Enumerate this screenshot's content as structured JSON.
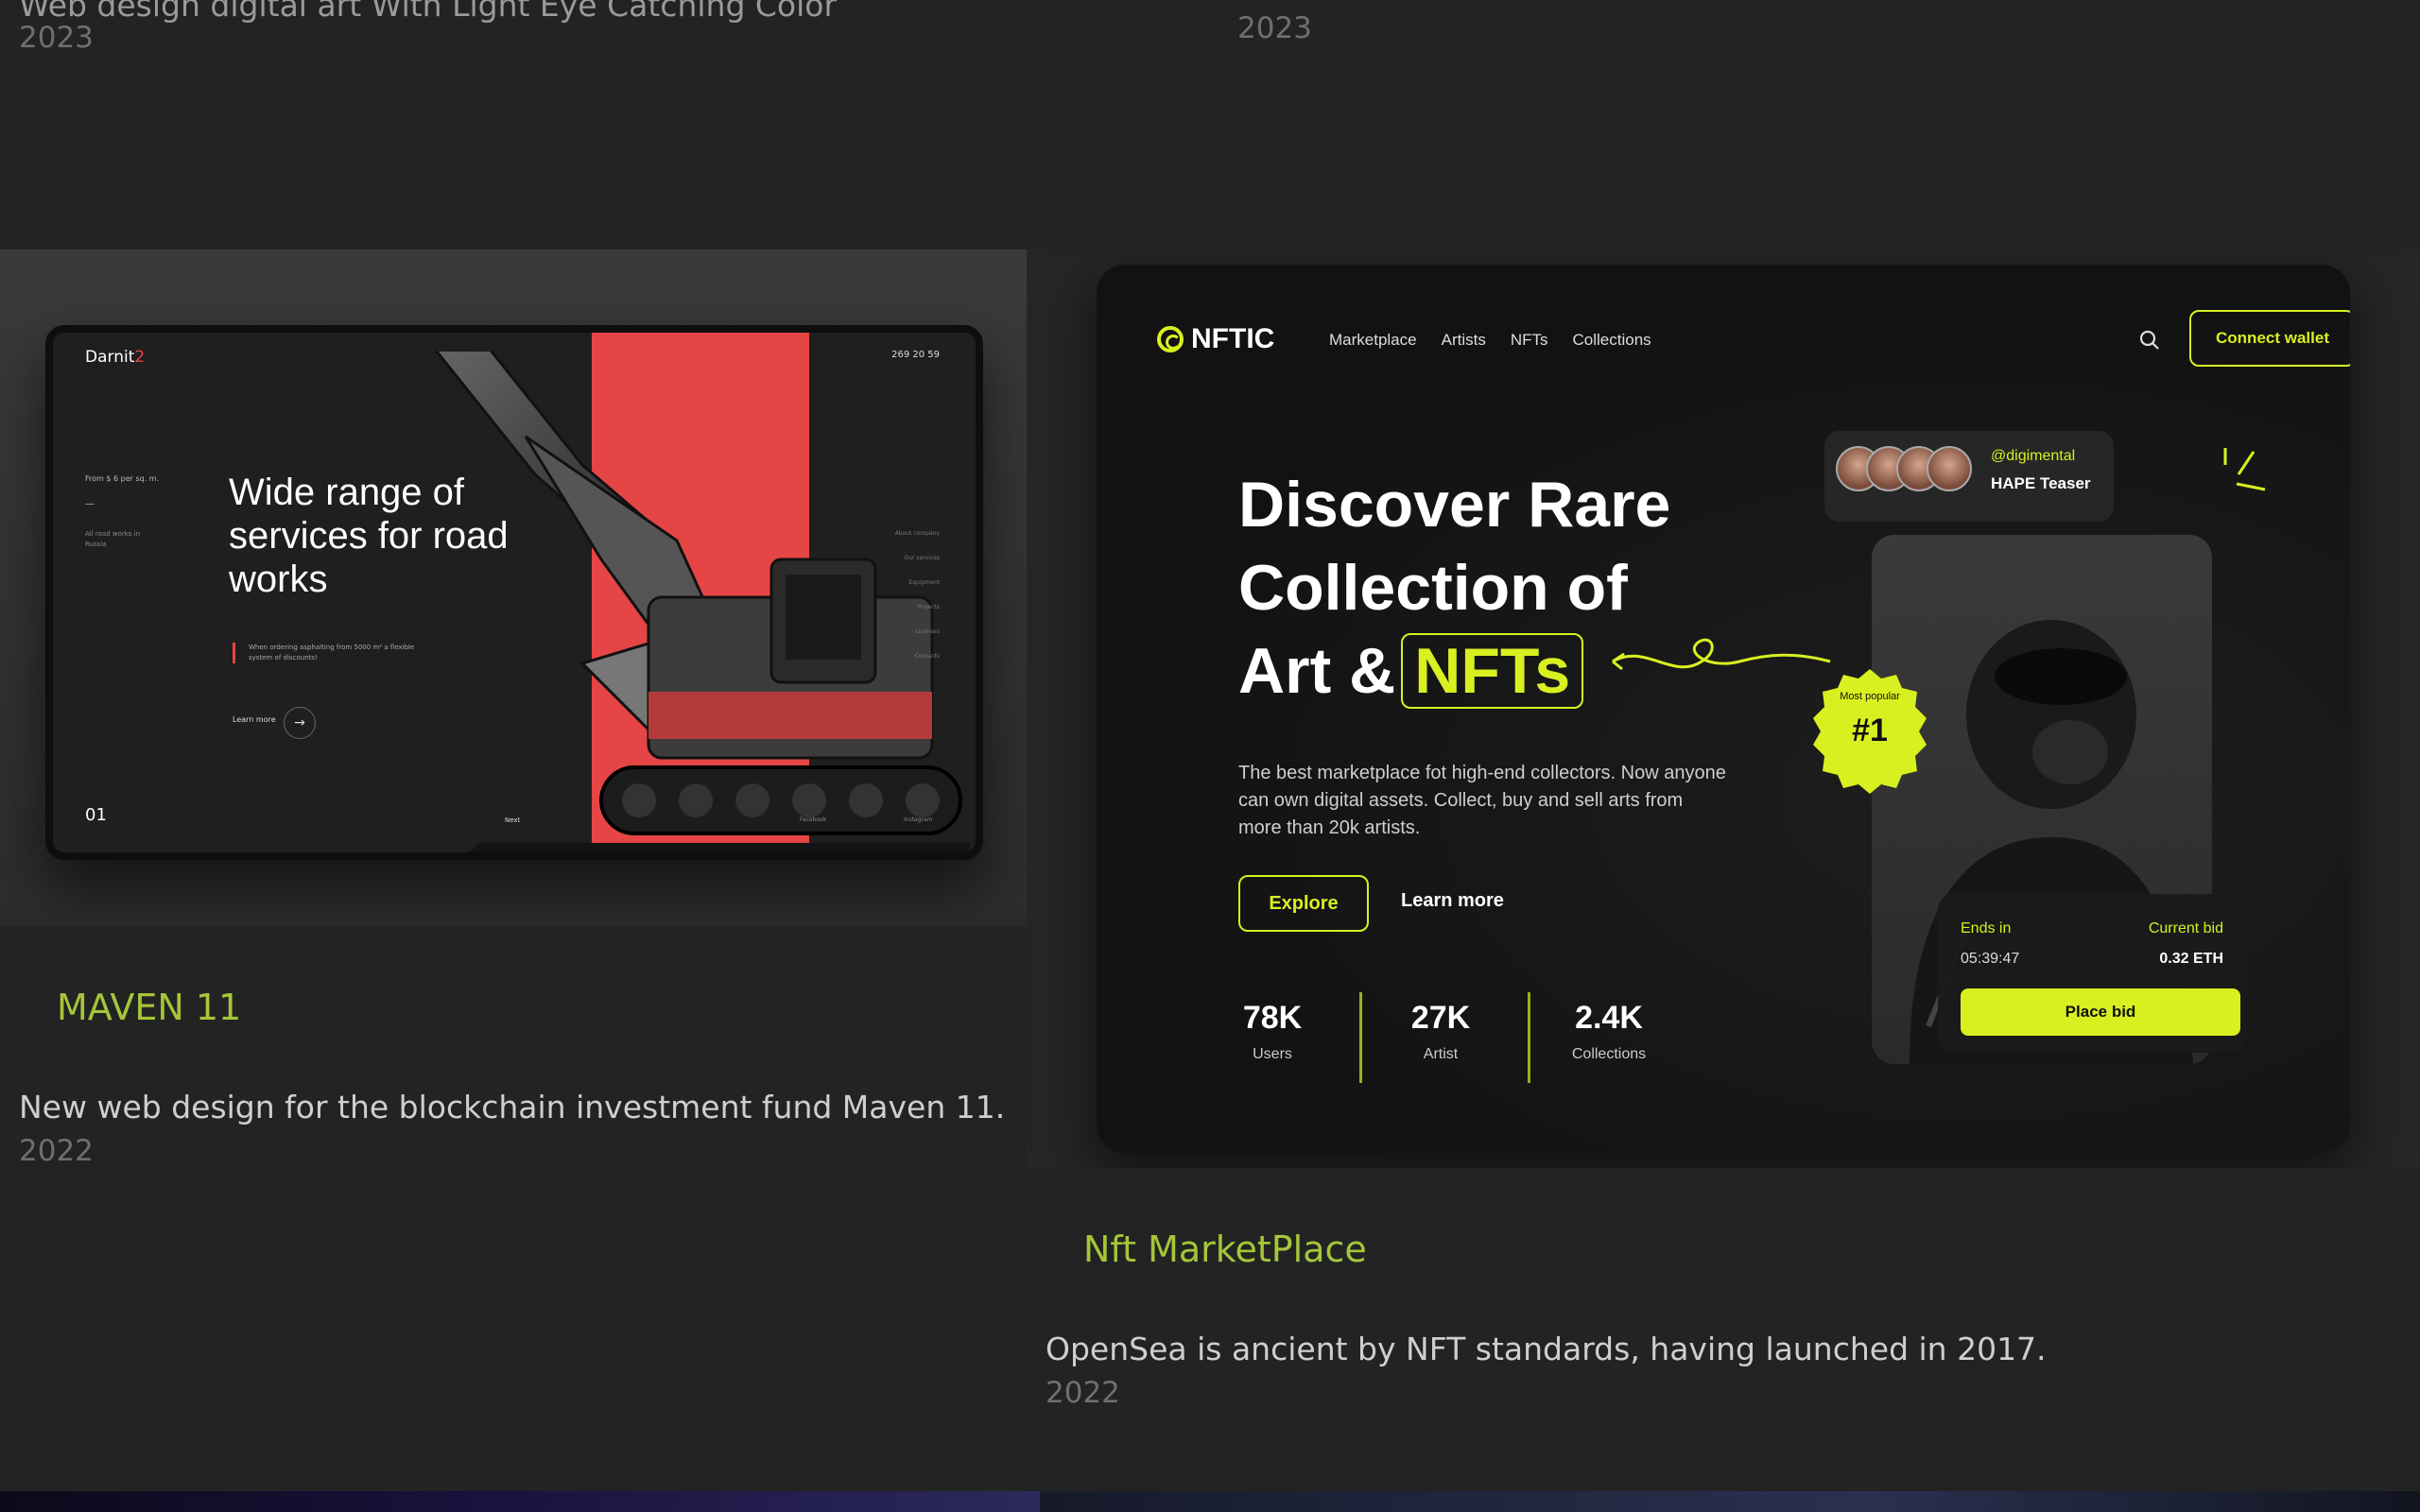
{
  "top_items": [
    {
      "desc": "Web design digital art With Light Eye Catching Color",
      "year": "2023"
    },
    {
      "desc": "",
      "year": "2023"
    }
  ],
  "projects": [
    {
      "title": "MAVEN 11",
      "desc": "New web design for the blockchain investment fund Maven 11.",
      "year": "2022"
    },
    {
      "title": "Nft MarketPlace",
      "desc": "OpenSea is ancient by NFT standards, having launched in 2017.",
      "year": "2022"
    }
  ],
  "mock_road": {
    "brand": "Darnit",
    "brand_accent": "2",
    "phone": "269 20 59",
    "price": "From $ 6 per sq. m.",
    "dash": "—",
    "allroad": "All road works in Russia",
    "headline": "Wide range of services for road works",
    "note": "When ordering asphalting from 5000 m² a flexible system of discounts!",
    "learn": "Learn more",
    "learn_arrow": "→",
    "menu": [
      "About company",
      "Our services",
      "Equipment",
      "Projects",
      "Licenses",
      "Contacts"
    ],
    "slide": "01",
    "next": "Next",
    "social1": "Facebook",
    "social2": "Instagram"
  },
  "mock_nft": {
    "logo": "NFTIC",
    "nav": [
      "Marketplace",
      "Artists",
      "NFTs",
      "Collections"
    ],
    "connect": "Connect wallet",
    "hero_line1": "Discover Rare",
    "hero_line2": "Collection of",
    "hero_line3": "Art &",
    "hero_highlight": "NFTs",
    "sub": "The best marketplace fot high-end collectors. Now anyone can own digital assets. Collect, buy and sell arts from more than 20k artists.",
    "explore": "Explore",
    "learn": "Learn more",
    "stats": [
      {
        "num": "78K",
        "label": "Users"
      },
      {
        "num": "27K",
        "label": "Artist"
      },
      {
        "num": "2.4K",
        "label": "Collections"
      }
    ],
    "handle": "@digimental",
    "teaser": "HAPE Teaser",
    "badge": "#1",
    "badge_ring": "Most popular",
    "ends_label": "Ends in",
    "time": "05:39:47",
    "current_label": "Current bid",
    "eth": "0.32 ETH",
    "place_bid": "Place bid"
  },
  "colors": {
    "accent_green": "#a6c63a",
    "nft_lime": "#d8f020",
    "road_red": "#e64545",
    "bg": "#232323"
  }
}
